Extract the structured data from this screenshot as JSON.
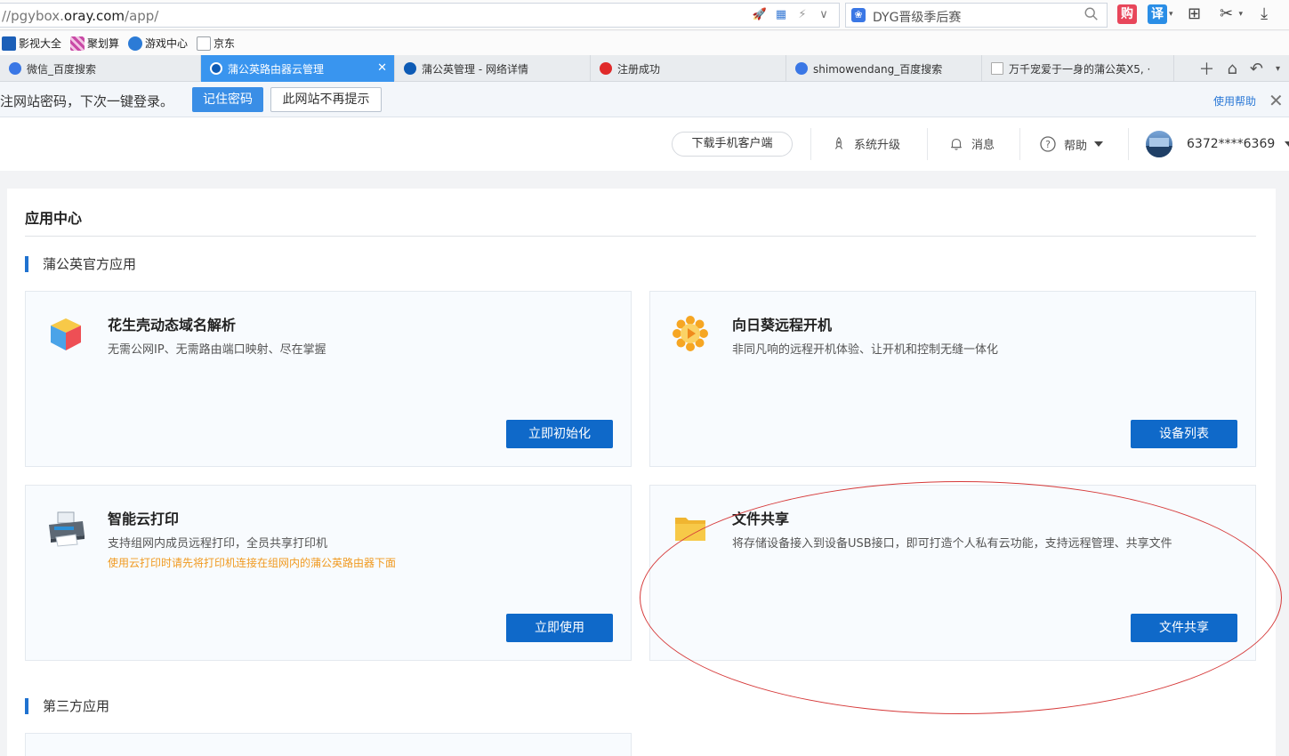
{
  "browser": {
    "url_prefix": "//pgybox.",
    "url_host": "oray.com",
    "url_path": "/app/",
    "search_text": "DYG晋级季后赛",
    "toolbar": {
      "buy_label": "购",
      "translate_label": "译"
    },
    "bookmarks": [
      {
        "label": "影视大全",
        "color": "#1b5fb8"
      },
      {
        "label": "聚划算",
        "color": "#c94aa6"
      },
      {
        "label": "游戏中心",
        "color": "#2c7bd6"
      },
      {
        "label": "京东",
        "color": "#9aa0a6"
      }
    ],
    "tabs": [
      {
        "label": "微信_百度搜索",
        "active": false
      },
      {
        "label": "蒲公英路由器云管理",
        "active": true
      },
      {
        "label": "蒲公英管理 - 网络详情",
        "active": false
      },
      {
        "label": "注册成功",
        "active": false
      },
      {
        "label": "shimowendang_百度搜索",
        "active": false
      },
      {
        "label": "万千宠爱于一身的蒲公英X5, ·",
        "active": false
      }
    ],
    "password_bar": {
      "message": "注网站密码，下次一键登录。",
      "remember_label": "记住密码",
      "never_label": "此网站不再提示",
      "help_label": "使用帮助"
    }
  },
  "topnav": {
    "download_label": "下载手机客户端",
    "upgrade_label": "系统升级",
    "messages_label": "消息",
    "help_label": "帮助",
    "user_name": "6372****6369"
  },
  "app_center": {
    "title": "应用中心",
    "official_section": "蒲公英官方应用",
    "third_party_section": "第三方应用",
    "cards": [
      {
        "title": "花生壳动态域名解析",
        "desc": "无需公网IP、无需路由端口映射、尽在掌握",
        "note": "",
        "button": "立即初始化",
        "icon": "cube-icon"
      },
      {
        "title": "向日葵远程开机",
        "desc": "非同凡响的远程开机体验、让开机和控制无缝一体化",
        "note": "",
        "button": "设备列表",
        "icon": "sunflower-icon"
      },
      {
        "title": "智能云打印",
        "desc": "支持组网内成员远程打印，全员共享打印机",
        "note": "使用云打印时请先将打印机连接在组网内的蒲公英路由器下面",
        "button": "立即使用",
        "icon": "printer-icon"
      },
      {
        "title": "文件共享",
        "desc": "将存储设备接入到设备USB接口，即可打造个人私有云功能，支持远程管理、共享文件",
        "note": "",
        "button": "文件共享",
        "icon": "folder-icon"
      }
    ]
  },
  "colors": {
    "primary_button": "#0f69c9",
    "accent_blue": "#1f72d0",
    "annotation_red": "#d63a3a",
    "note_orange": "#f09a20"
  }
}
